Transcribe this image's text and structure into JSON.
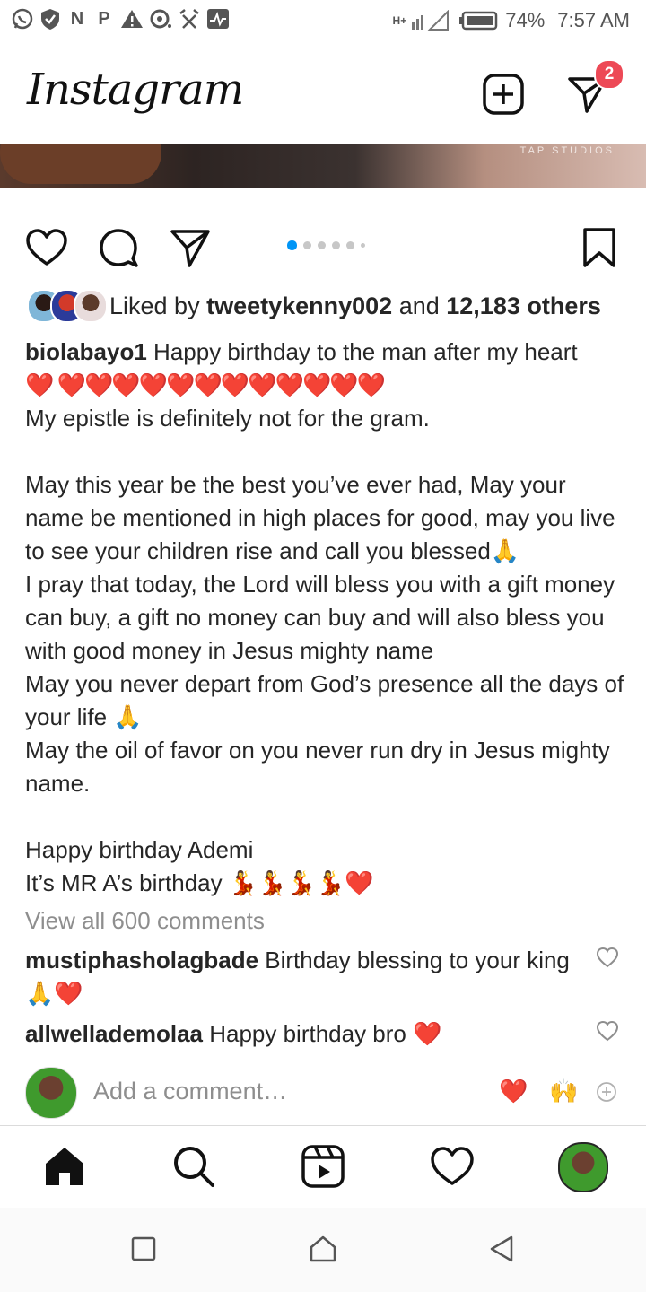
{
  "status_bar": {
    "left_icons": [
      "whatsapp-icon",
      "shield-icon",
      "N",
      "P",
      "warning-icon",
      "record-icon",
      "clock-off-icon",
      "activity-icon"
    ],
    "network": "H+",
    "battery": "74%",
    "time": "7:57 AM"
  },
  "header": {
    "logo": "Instagram",
    "dm_badge": "2"
  },
  "post": {
    "image_watermark": "TAP STUDIOS",
    "carousel": {
      "count": 6,
      "active_index": 0
    },
    "likes": {
      "prefix": "Liked by ",
      "user": "tweetykenny002",
      "middle": " and ",
      "count": "12,183 others"
    },
    "caption": {
      "username": "biolabayo1",
      "line1": " Happy birthday to the man after my heart",
      "hearts_line": "❤️ ❤️❤️❤️❤️❤️❤️❤️❤️❤️❤️❤️❤️",
      "body": "My epistle is definitely not for the gram.\n\nMay this year be the best you’ve ever had, May your name be mentioned in high places for good, may you live to see your children rise and call you blessed🙏\nI pray that today, the Lord will bless you with a gift money can buy, a gift no money can buy and will also bless you with good money in Jesus mighty name\nMay you never depart from God’s presence all the days of your life 🙏\nMay the oil of favor on you never run dry in Jesus mighty name.\n\nHappy birthday Ademi\nIt’s MR A’s birthday 💃💃💃💃❤️"
    },
    "view_all": "View all 600 comments",
    "comments": [
      {
        "user": "mustiphasholagbade",
        "text": " Birthday blessing to your king 🙏❤️"
      },
      {
        "user": "allwellademolaa",
        "text": " Happy birthday bro ❤️"
      }
    ],
    "add_comment": {
      "placeholder": "Add a comment…",
      "quick_emojis": [
        "❤️",
        "🙌"
      ]
    }
  },
  "bottom_nav": [
    "home-icon",
    "search-icon",
    "reels-icon",
    "activity-heart-icon",
    "profile-avatar"
  ],
  "system_nav": [
    "recents-square",
    "home-circle",
    "back-triangle"
  ],
  "colors": {
    "accent_blue": "#0095f6",
    "badge_red": "#ed4956",
    "heart_red": "#e0142a",
    "muted": "#8e8e8e"
  }
}
